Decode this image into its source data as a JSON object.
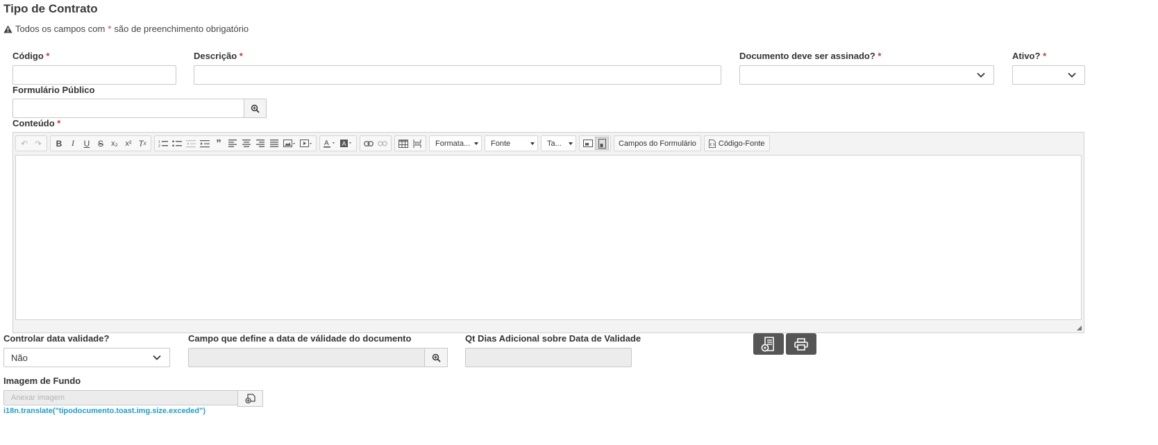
{
  "page": {
    "title": "Tipo de Contrato",
    "notice_prefix": "Todos os campos com",
    "notice_star": "*",
    "notice_suffix": "são de preenchimento obrigatório"
  },
  "fields": {
    "codigo": {
      "label": "Código",
      "value": ""
    },
    "descricao": {
      "label": "Descrição",
      "value": ""
    },
    "documento_assinado": {
      "label": "Documento deve ser assinado?",
      "value": ""
    },
    "ativo": {
      "label": "Ativo?",
      "value": ""
    },
    "formulario_publico": {
      "label": "Formulário Público",
      "value": ""
    },
    "conteudo": {
      "label": "Conteúdo"
    },
    "controlar_validade": {
      "label": "Controlar data validade?",
      "value": "Não"
    },
    "campo_validade": {
      "label": "Campo que define a data de válidade do documento",
      "value": ""
    },
    "qt_dias": {
      "label": "Qt Dias Adicional sobre Data de Validade",
      "value": ""
    },
    "imagem_fundo": {
      "label": "Imagem de Fundo",
      "placeholder": "Anexar imagem"
    }
  },
  "required_mark": "*",
  "toolbar": {
    "format_label": "Formata...",
    "font_label": "Fonte",
    "size_label": "Ta...",
    "form_fields_label": "Campos do Formulário",
    "source_label": "Código-Fonte"
  },
  "hint_text": "i18n.translate(\"tipodocumento.toast.img.size.exceded\")"
}
